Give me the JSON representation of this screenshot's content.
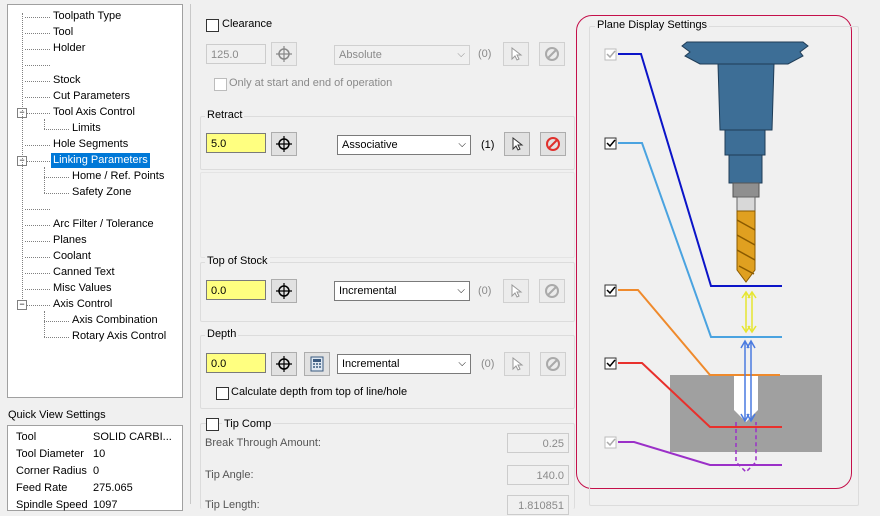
{
  "tree": {
    "items": [
      {
        "label": "Toolpath Type",
        "indent": 0
      },
      {
        "label": "Tool",
        "indent": 0
      },
      {
        "label": "Holder",
        "indent": 0
      },
      {
        "label": "",
        "indent": 0
      },
      {
        "label": "Stock",
        "indent": 0
      },
      {
        "label": "Cut Parameters",
        "indent": 0
      },
      {
        "label": "Tool Axis Control",
        "indent": 0,
        "expander": "−"
      },
      {
        "label": "Limits",
        "indent": 1
      },
      {
        "label": "Hole Segments",
        "indent": 0
      },
      {
        "label": "Linking Parameters",
        "indent": 0,
        "expander": "−",
        "selected": true
      },
      {
        "label": "Home / Ref. Points",
        "indent": 1
      },
      {
        "label": "Safety Zone",
        "indent": 1
      },
      {
        "label": "",
        "indent": 0
      },
      {
        "label": "Arc Filter / Tolerance",
        "indent": 0
      },
      {
        "label": "Planes",
        "indent": 0
      },
      {
        "label": "Coolant",
        "indent": 0
      },
      {
        "label": "Canned Text",
        "indent": 0
      },
      {
        "label": "Misc Values",
        "indent": 0
      },
      {
        "label": "Axis Control",
        "indent": 0,
        "expander": "−"
      },
      {
        "label": "Axis Combination",
        "indent": 1
      },
      {
        "label": "Rotary Axis Control",
        "indent": 1
      }
    ]
  },
  "quick_view": {
    "title": "Quick View Settings",
    "rows": [
      {
        "key": "Tool",
        "value": "SOLID CARBI..."
      },
      {
        "key": "Tool Diameter",
        "value": "10"
      },
      {
        "key": "Corner Radius",
        "value": "0"
      },
      {
        "key": "Feed Rate",
        "value": "275.065"
      },
      {
        "key": "Spindle Speed",
        "value": "1097"
      }
    ]
  },
  "clearance": {
    "label": "Clearance",
    "value": "125.0",
    "mode": "Absolute",
    "count": "(0)",
    "only_label": "Only at start and end of operation"
  },
  "retract": {
    "label": "Retract",
    "value": "5.0",
    "mode": "Associative",
    "count": "(1)"
  },
  "top_of_stock": {
    "label": "Top of Stock",
    "value": "0.0",
    "mode": "Incremental",
    "count": "(0)"
  },
  "depth": {
    "label": "Depth",
    "value": "0.0",
    "mode": "Incremental",
    "count": "(0)",
    "calc_label": "Calculate depth from top of line/hole"
  },
  "tip_comp": {
    "label": "Tip Comp",
    "break_label": "Break Through Amount:",
    "break_value": "0.25",
    "angle_label": "Tip Angle:",
    "angle_value": "140.0",
    "length_label": "Tip Length:",
    "length_value": "1.810851"
  },
  "plane_display": {
    "title": "Plane Display Settings",
    "colors": {
      "clearance": "#0b14c8",
      "retract": "#4aa3e0",
      "top": "#ef8a2c",
      "depth": "#e8302c",
      "tip": "#9b30c8",
      "tool_body": "#3d6e96",
      "drill": "#e0a020",
      "stock": "#a0a0a0",
      "highlight": "#c4104a"
    }
  }
}
